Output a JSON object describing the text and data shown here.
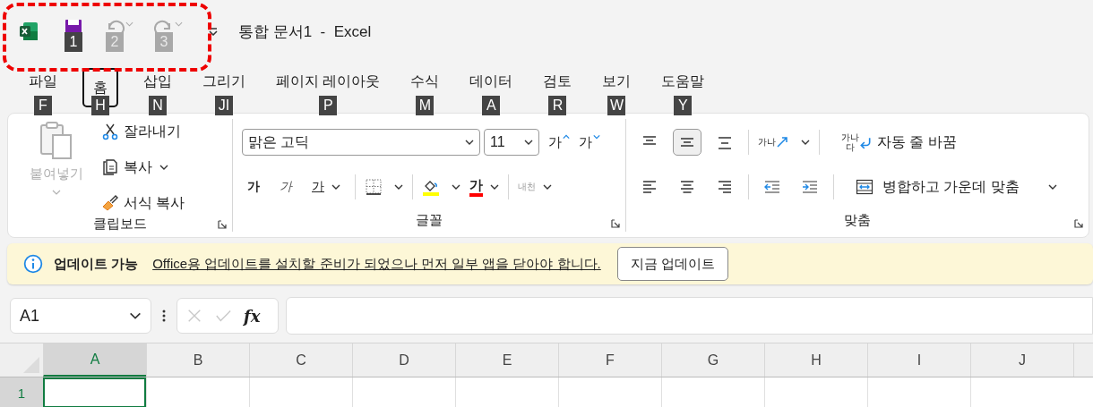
{
  "title_bar": {
    "quick_access": [
      {
        "kind": "save",
        "keytip": "1",
        "disabled": false
      },
      {
        "kind": "undo",
        "keytip": "2",
        "disabled": true
      },
      {
        "kind": "redo",
        "keytip": "3",
        "disabled": true
      }
    ],
    "title": "통합 문서1  -  Excel"
  },
  "tabs": [
    {
      "label": "파일",
      "keytip": "F",
      "selected": false
    },
    {
      "label": "홈",
      "keytip": "H",
      "selected": true
    },
    {
      "label": "삽입",
      "keytip": "N",
      "selected": false
    },
    {
      "label": "그리기",
      "keytip": "JI",
      "selected": false
    },
    {
      "label": "페이지 레이아웃",
      "keytip": "P",
      "selected": false
    },
    {
      "label": "수식",
      "keytip": "M",
      "selected": false
    },
    {
      "label": "데이터",
      "keytip": "A",
      "selected": false
    },
    {
      "label": "검토",
      "keytip": "R",
      "selected": false
    },
    {
      "label": "보기",
      "keytip": "W",
      "selected": false
    },
    {
      "label": "도움말",
      "keytip": "Y",
      "selected": false
    }
  ],
  "ribbon": {
    "clipboard": {
      "label": "클립보드",
      "paste": {
        "label": "붙여넣기",
        "disabled": true
      },
      "items": [
        {
          "kind": "cut",
          "label": "잘라내기",
          "dropdown": false
        },
        {
          "kind": "copy",
          "label": "복사",
          "dropdown": true
        },
        {
          "kind": "painter",
          "label": "서식 복사",
          "dropdown": false
        }
      ]
    },
    "font": {
      "label": "글꼴",
      "font_name": "맑은 고딕",
      "font_size": "11",
      "grow": "가",
      "shrink": "가",
      "styles": [
        {
          "kind": "bold",
          "text": "가"
        },
        {
          "kind": "italic",
          "text": "가"
        },
        {
          "kind": "underline",
          "text": "가"
        }
      ],
      "font_color": "가",
      "phonetic": "내천"
    },
    "alignment": {
      "label": "맞춤",
      "vertical": [
        {
          "kind": "top",
          "selected": false
        },
        {
          "kind": "middle",
          "selected": true
        },
        {
          "kind": "bottom",
          "selected": false
        }
      ],
      "horizontal": [
        {
          "kind": "left",
          "selected": false
        },
        {
          "kind": "center",
          "selected": false
        },
        {
          "kind": "right",
          "selected": false
        }
      ],
      "orientation_icon": "가나",
      "wrap_text": {
        "icon_text": [
          "가나",
          "다"
        ],
        "label": "자동 줄 바꿈"
      },
      "merge": "병합하고 가운데 맞춤"
    }
  },
  "notification": {
    "title": "업데이트 가능",
    "message": "Office용 업데이트를 설치할 준비가 되었으나 먼저 일부 앱을 닫아야 합니다.",
    "button": "지금 업데이트"
  },
  "formula_bar": {
    "name_box": "A1",
    "function_symbol": "fx"
  },
  "grid": {
    "columns": [
      {
        "label": "A",
        "selected": true
      },
      {
        "label": "B",
        "selected": false
      },
      {
        "label": "C",
        "selected": false
      },
      {
        "label": "D",
        "selected": false
      },
      {
        "label": "E",
        "selected": false
      },
      {
        "label": "F",
        "selected": false
      },
      {
        "label": "G",
        "selected": false
      },
      {
        "label": "H",
        "selected": false
      },
      {
        "label": "I",
        "selected": false
      },
      {
        "label": "J",
        "selected": false
      }
    ],
    "rows": [
      {
        "label": "1",
        "selected": true
      }
    ]
  }
}
